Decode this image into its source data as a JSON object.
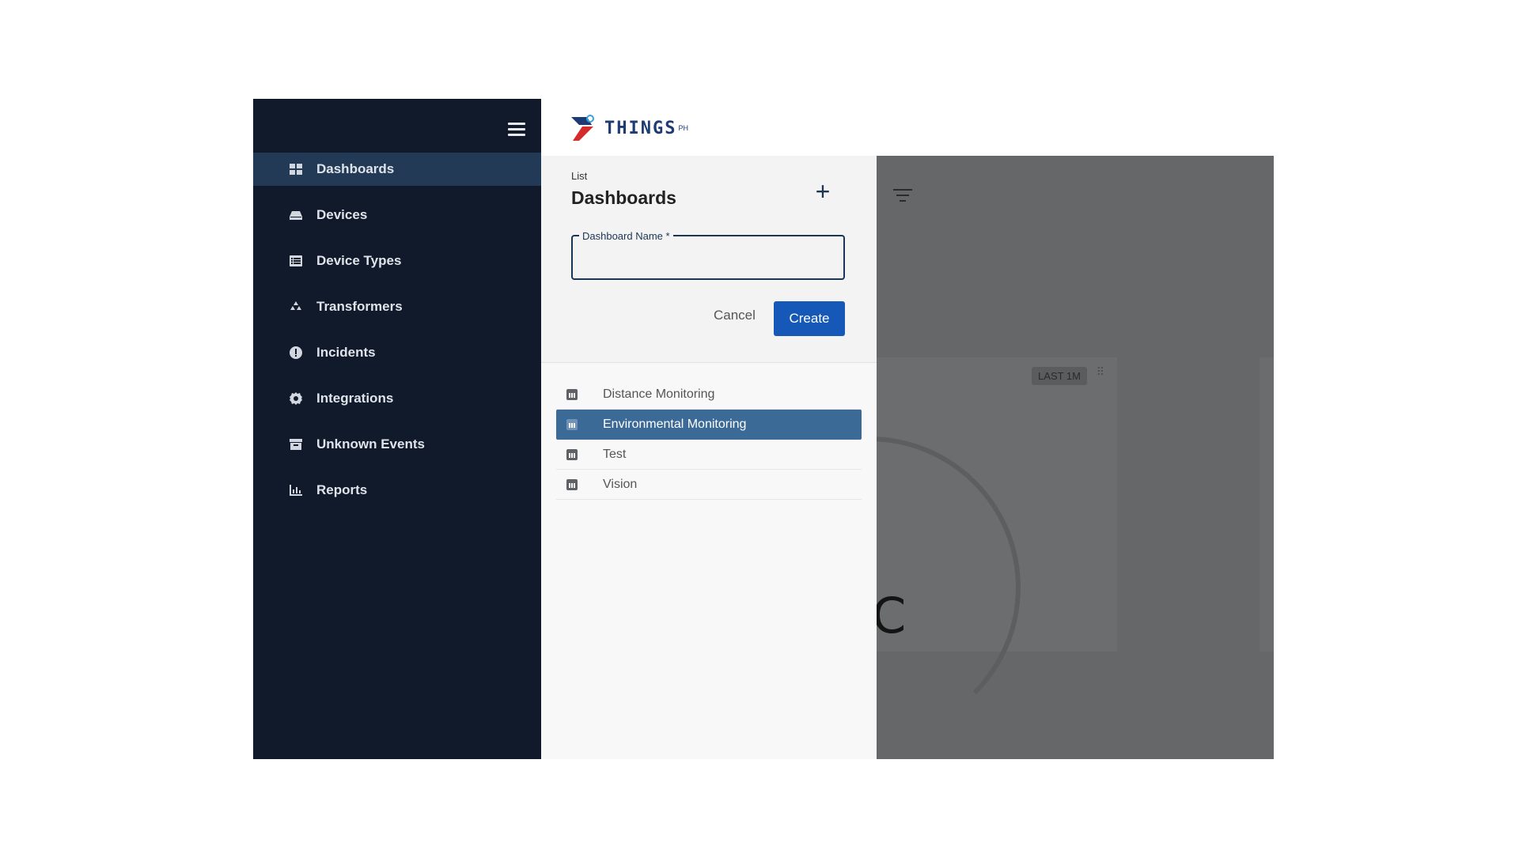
{
  "sidebar": {
    "items": [
      {
        "label": "Dashboards",
        "icon": "dashboard-icon"
      },
      {
        "label": "Devices",
        "icon": "device-icon"
      },
      {
        "label": "Device Types",
        "icon": "list-icon"
      },
      {
        "label": "Transformers",
        "icon": "recycle-icon"
      },
      {
        "label": "Incidents",
        "icon": "alert-icon"
      },
      {
        "label": "Integrations",
        "icon": "gear-icon"
      },
      {
        "label": "Unknown Events",
        "icon": "archive-icon"
      },
      {
        "label": "Reports",
        "icon": "bar-chart-icon"
      }
    ]
  },
  "brand": {
    "name": "THINGS",
    "sup": "PH"
  },
  "panel": {
    "breadcrumb": "List",
    "title": "Dashboards",
    "field_label": "Dashboard Name *",
    "field_value": "",
    "cancel_label": "Cancel",
    "create_label": "Create",
    "list": [
      {
        "label": "Distance Monitoring"
      },
      {
        "label": "Environmental Monitoring"
      },
      {
        "label": "Test"
      },
      {
        "label": "Vision"
      }
    ]
  },
  "backdrop": {
    "badge": "LAST 1M",
    "gauge_text": "C"
  },
  "colors": {
    "sidebar_bg": "#111a2b",
    "active_item": "#223a55",
    "primary_button": "#1658b7",
    "selected_row": "#3c6a97"
  }
}
